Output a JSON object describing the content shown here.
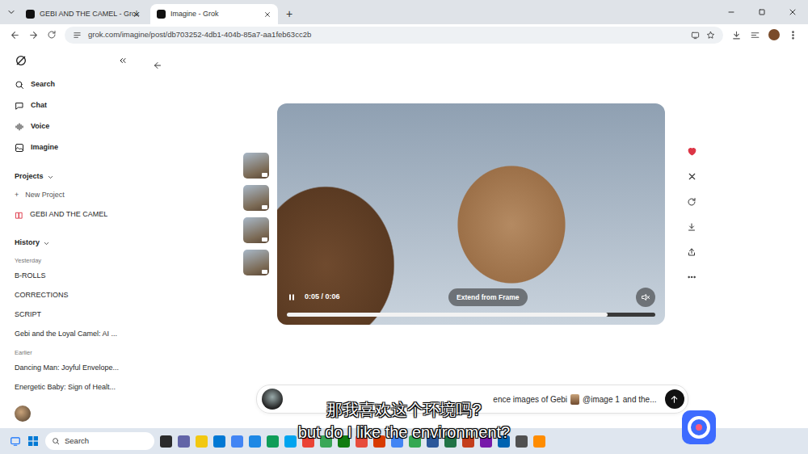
{
  "browser": {
    "tabs": [
      {
        "label": "GEBI AND THE CAMEL - Grok",
        "selected": false
      },
      {
        "label": "Imagine - Grok",
        "selected": true
      }
    ],
    "new_tab": "+",
    "url": "grok.com/imagine/post/db703252-4db1-404b-85a7-aa1feb63cc2b"
  },
  "sidebar": {
    "nav": [
      "Search",
      "Chat",
      "Voice",
      "Imagine"
    ],
    "projects": {
      "heading": "Projects",
      "new_icon": "+",
      "new": "New Project",
      "items": [
        "GEBI AND THE CAMEL"
      ]
    },
    "history": {
      "heading": "History",
      "groups": [
        {
          "label": "Yesterday",
          "items": [
            "B-ROLLS",
            "CORRECTIONS",
            "SCRIPT",
            "Gebi and the Loyal Camel: AI ..."
          ]
        },
        {
          "label": "Earlier",
          "items": [
            "Dancing Man: Joyful Envelope...",
            "Energetic Baby: Sign of Healt..."
          ]
        }
      ]
    }
  },
  "player": {
    "playing": true,
    "time": "0:05 / 0:06",
    "extend": "Extend from Frame",
    "muted": true,
    "level": 0.87,
    "thumbnails": [
      {
        "selected": false
      },
      {
        "selected": false
      },
      {
        "selected": false
      },
      {
        "selected": false
      }
    ]
  },
  "actions": {
    "liked": true
  },
  "composer": {
    "text": "ence images of Gebi",
    "mention": "@image 1",
    "after": "and the..."
  },
  "subtitles": [
    "那我喜欢这个环境吗?",
    "but do I like the environment?"
  ],
  "taskbar": {
    "search": "Search"
  }
}
